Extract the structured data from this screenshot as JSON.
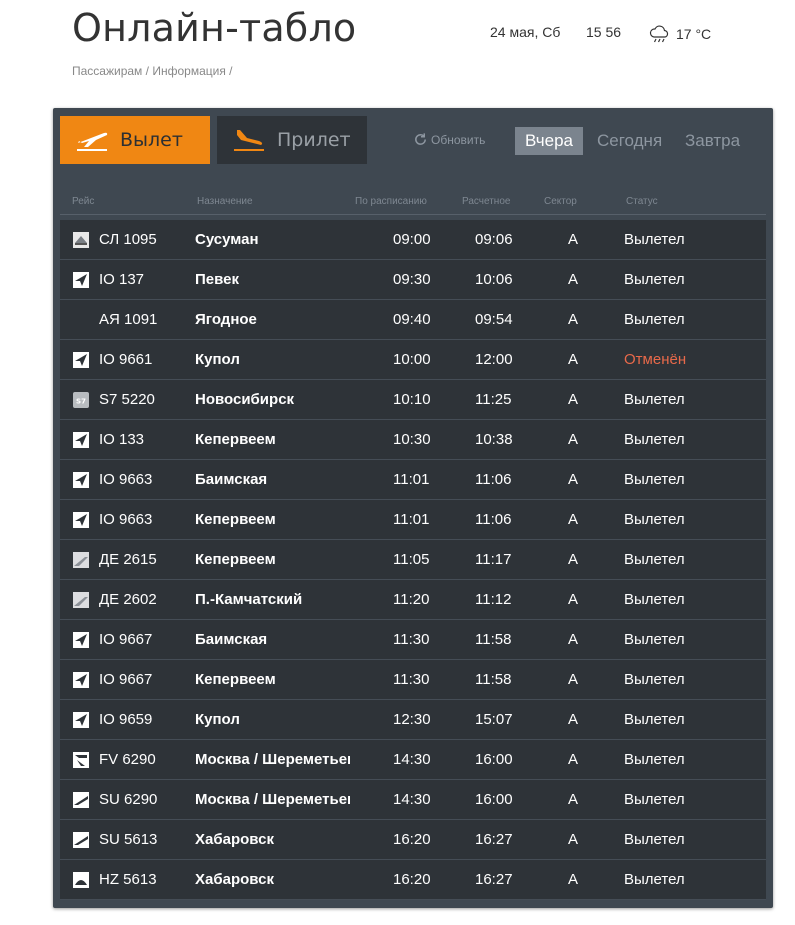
{
  "header": {
    "title": "Онлайн-табло",
    "date": "24 мая, Сб",
    "time": "15 56",
    "temperature": "17 °C",
    "weather_icon": "cloud-rain-icon",
    "breadcrumbs": [
      "Пассажирам",
      "/",
      "Информация",
      "/"
    ]
  },
  "tabs": {
    "departure": "Вылет",
    "arrival": "Прилет"
  },
  "refresh_label": "Обновить",
  "days": {
    "yesterday": "Вчера",
    "today": "Сегодня",
    "tomorrow": "Завтра",
    "selected": "yesterday"
  },
  "columns": {
    "flight": "Рейс",
    "destination": "Назначение",
    "scheduled": "По расписанию",
    "estimated": "Расчетное",
    "sector": "Сектор",
    "status": "Статус"
  },
  "colors": {
    "accent": "#f08713",
    "board_bg": "#3f4851",
    "row_bg": "#2e3338",
    "cancelled": "#e8694a"
  },
  "flights": [
    {
      "logo": "airline-logo-sl",
      "flight": "СЛ 1095",
      "destination": "Сусуман",
      "scheduled": "09:00",
      "estimated": "09:06",
      "sector": "A",
      "status": "Вылетел",
      "cancelled": false
    },
    {
      "logo": "airline-logo-io",
      "flight": "IO 137",
      "destination": "Певек",
      "scheduled": "09:30",
      "estimated": "10:06",
      "sector": "A",
      "status": "Вылетел",
      "cancelled": false
    },
    {
      "logo": "",
      "flight": "АЯ 1091",
      "destination": "Ягодное",
      "scheduled": "09:40",
      "estimated": "09:54",
      "sector": "A",
      "status": "Вылетел",
      "cancelled": false
    },
    {
      "logo": "airline-logo-io",
      "flight": "IO 9661",
      "destination": "Купол",
      "scheduled": "10:00",
      "estimated": "12:00",
      "sector": "A",
      "status": "Отменён",
      "cancelled": true
    },
    {
      "logo": "airline-logo-s7",
      "flight": "S7 5220",
      "destination": "Новосибирск",
      "scheduled": "10:10",
      "estimated": "11:25",
      "sector": "A",
      "status": "Вылетел",
      "cancelled": false
    },
    {
      "logo": "airline-logo-io",
      "flight": "IO 133",
      "destination": "Кепервеем",
      "scheduled": "10:30",
      "estimated": "10:38",
      "sector": "A",
      "status": "Вылетел",
      "cancelled": false
    },
    {
      "logo": "airline-logo-io",
      "flight": "IO 9663",
      "destination": "Баимская",
      "scheduled": "11:01",
      "estimated": "11:06",
      "sector": "A",
      "status": "Вылетел",
      "cancelled": false
    },
    {
      "logo": "airline-logo-io",
      "flight": "IO 9663",
      "destination": "Кепервеем",
      "scheduled": "11:01",
      "estimated": "11:06",
      "sector": "A",
      "status": "Вылетел",
      "cancelled": false
    },
    {
      "logo": "airline-logo-de",
      "flight": "ДЕ 2615",
      "destination": "Кепервеем",
      "scheduled": "11:05",
      "estimated": "11:17",
      "sector": "A",
      "status": "Вылетел",
      "cancelled": false
    },
    {
      "logo": "airline-logo-de",
      "flight": "ДЕ 2602",
      "destination": "П.-Камчатский",
      "scheduled": "11:20",
      "estimated": "11:12",
      "sector": "A",
      "status": "Вылетел",
      "cancelled": false
    },
    {
      "logo": "airline-logo-io",
      "flight": "IO 9667",
      "destination": "Баимская",
      "scheduled": "11:30",
      "estimated": "11:58",
      "sector": "A",
      "status": "Вылетел",
      "cancelled": false
    },
    {
      "logo": "airline-logo-io",
      "flight": "IO 9667",
      "destination": "Кепервеем",
      "scheduled": "11:30",
      "estimated": "11:58",
      "sector": "A",
      "status": "Вылетел",
      "cancelled": false
    },
    {
      "logo": "airline-logo-io",
      "flight": "IO 9659",
      "destination": "Купол",
      "scheduled": "12:30",
      "estimated": "15:07",
      "sector": "A",
      "status": "Вылетел",
      "cancelled": false
    },
    {
      "logo": "airline-logo-fv",
      "flight": "FV 6290",
      "destination": "Москва / Шереметьево",
      "scheduled": "14:30",
      "estimated": "16:00",
      "sector": "A",
      "status": "Вылетел",
      "cancelled": false
    },
    {
      "logo": "airline-logo-su",
      "flight": "SU 6290",
      "destination": "Москва / Шереметьево",
      "scheduled": "14:30",
      "estimated": "16:00",
      "sector": "A",
      "status": "Вылетел",
      "cancelled": false
    },
    {
      "logo": "airline-logo-su",
      "flight": "SU 5613",
      "destination": "Хабаровск",
      "scheduled": "16:20",
      "estimated": "16:27",
      "sector": "A",
      "status": "Вылетел",
      "cancelled": false
    },
    {
      "logo": "airline-logo-hz",
      "flight": "HZ 5613",
      "destination": "Хабаровск",
      "scheduled": "16:20",
      "estimated": "16:27",
      "sector": "A",
      "status": "Вылетел",
      "cancelled": false
    }
  ]
}
